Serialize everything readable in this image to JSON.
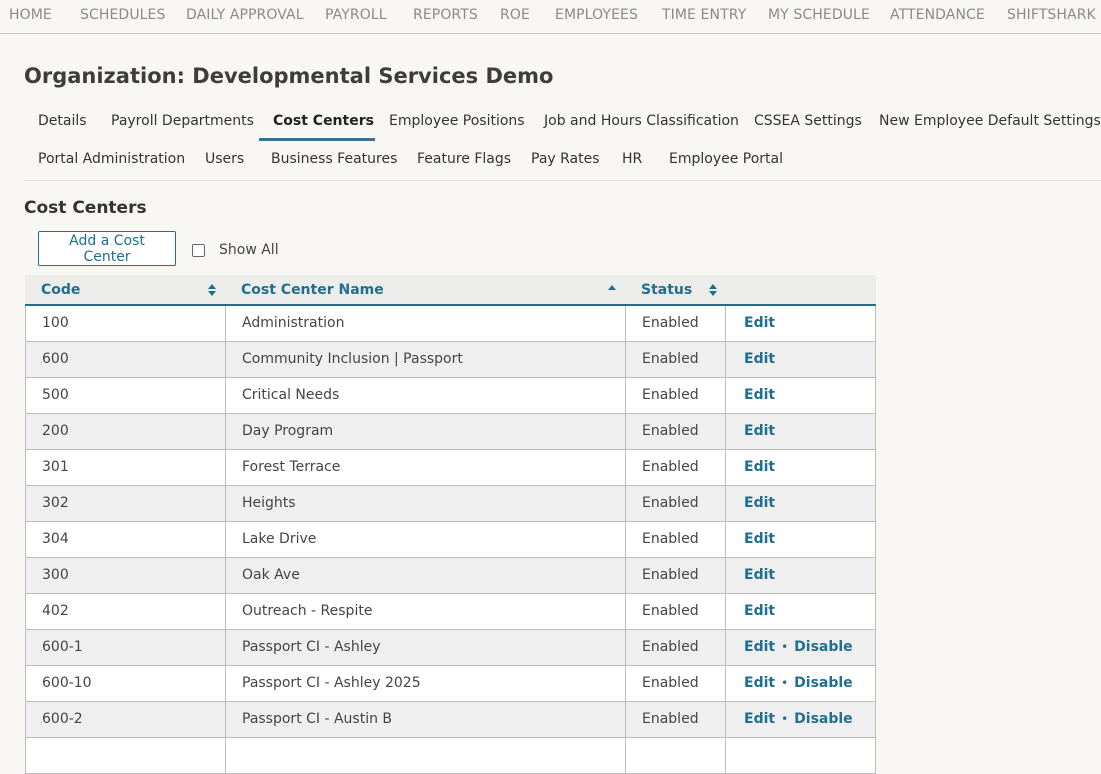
{
  "topnav": [
    "HOME",
    "SCHEDULES",
    "DAILY APPROVAL",
    "PAYROLL",
    "REPORTS",
    "ROE",
    "EMPLOYEES",
    "TIME ENTRY",
    "MY SCHEDULE",
    "ATTENDANCE",
    "SHIFTSHARK"
  ],
  "org_title": "Organization: Developmental Services Demo",
  "tabs_row1": [
    "Details",
    "Payroll Departments",
    "Cost Centers",
    "Employee Positions",
    "Job and Hours Classification",
    "CSSEA Settings",
    "New Employee Default Settings"
  ],
  "tabs_row2": [
    "Portal Administration",
    "Users",
    "Business Features",
    "Feature Flags",
    "Pay Rates",
    "HR",
    "Employee Portal"
  ],
  "active_tab": "Cost Centers",
  "section_title": "Cost Centers",
  "add_button": "Add a Cost Center",
  "show_all_label": "Show All",
  "show_all_checked": false,
  "columns": [
    "Code",
    "Cost Center Name",
    "Status"
  ],
  "sort": {
    "column": "Cost Center Name",
    "direction": "ascending"
  },
  "colors": {
    "accent": "#1f6f8e",
    "active_underline": "#3a6f8f"
  },
  "rows": [
    {
      "code": "100",
      "name": "Administration",
      "status": "Enabled",
      "actions": [
        "Edit"
      ]
    },
    {
      "code": "600",
      "name": "Community Inclusion | Passport",
      "status": "Enabled",
      "actions": [
        "Edit"
      ]
    },
    {
      "code": "500",
      "name": "Critical Needs",
      "status": "Enabled",
      "actions": [
        "Edit"
      ]
    },
    {
      "code": "200",
      "name": "Day Program",
      "status": "Enabled",
      "actions": [
        "Edit"
      ]
    },
    {
      "code": "301",
      "name": "Forest Terrace",
      "status": "Enabled",
      "actions": [
        "Edit"
      ]
    },
    {
      "code": "302",
      "name": "Heights",
      "status": "Enabled",
      "actions": [
        "Edit"
      ]
    },
    {
      "code": "304",
      "name": "Lake Drive",
      "status": "Enabled",
      "actions": [
        "Edit"
      ]
    },
    {
      "code": "300",
      "name": "Oak Ave",
      "status": "Enabled",
      "actions": [
        "Edit"
      ]
    },
    {
      "code": "402",
      "name": "Outreach - Respite",
      "status": "Enabled",
      "actions": [
        "Edit"
      ]
    },
    {
      "code": "600-1",
      "name": "Passport CI - Ashley",
      "status": "Enabled",
      "actions": [
        "Edit",
        "Disable"
      ]
    },
    {
      "code": "600-10",
      "name": "Passport CI - Ashley 2025",
      "status": "Enabled",
      "actions": [
        "Edit",
        "Disable"
      ]
    },
    {
      "code": "600-2",
      "name": "Passport CI - Austin B",
      "status": "Enabled",
      "actions": [
        "Edit",
        "Disable"
      ]
    },
    {
      "code": "",
      "name": "",
      "status": "",
      "actions": []
    }
  ]
}
